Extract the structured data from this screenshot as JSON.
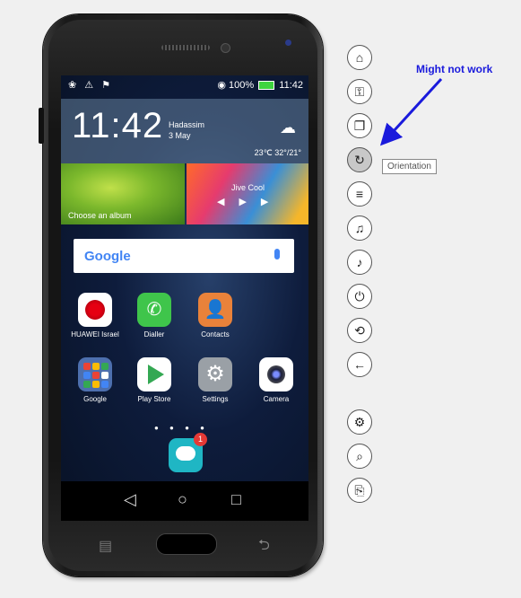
{
  "status_bar": {
    "left_icons": "❀ ⚠ ⚑",
    "wifi_signal": "◉",
    "battery_percent": "100%",
    "time": "11:42"
  },
  "clock_widget": {
    "time": "11:42",
    "city": "Hadassim",
    "date": "3 May",
    "weather_icon": "cloud-icon",
    "temperature": "23℃ 32°/21°"
  },
  "tiles": {
    "album_label": "Choose an album",
    "music_label": "Jive Cool"
  },
  "search": {
    "logo_text": "Google"
  },
  "apps_row1": [
    {
      "name": "HUAWEI Israel"
    },
    {
      "name": "Dialler"
    },
    {
      "name": "Contacts"
    }
  ],
  "apps_row2": [
    {
      "name": "Google"
    },
    {
      "name": "Play Store"
    },
    {
      "name": "Settings"
    },
    {
      "name": "Camera"
    }
  ],
  "dock": {
    "badge_count": "1"
  },
  "navbar": {
    "back": "◁",
    "home": "○",
    "recents": "□"
  },
  "hardware": {
    "menu": "▤",
    "back": "⮌"
  },
  "toolbar": {
    "home": "⌂",
    "lock": "⚿",
    "copy": "❐",
    "orientation": "↻",
    "menu": "≡",
    "vol_up": "♫",
    "vol_down": "♪",
    "power": "⏻",
    "rotate": "⟲",
    "back": "←",
    "settings": "⚙",
    "zoom": "⌕",
    "exit": "⎘"
  },
  "tooltip": "Orientation",
  "annotation": "Might not work"
}
